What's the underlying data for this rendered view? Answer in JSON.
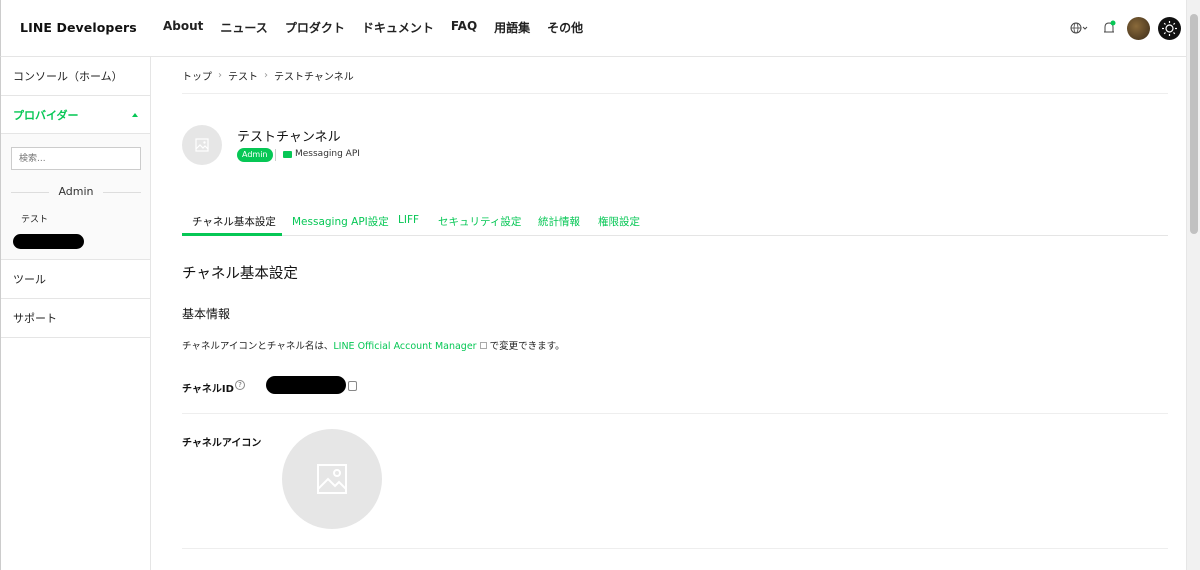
{
  "header": {
    "logo": "LINE Developers",
    "nav": [
      "About",
      "ニュース",
      "プロダクト",
      "ドキュメント",
      "FAQ",
      "用語集",
      "その他"
    ],
    "icons": {
      "language": "globe-icon",
      "notification": "bell-icon",
      "theme": "sun-icon"
    }
  },
  "sidebar": {
    "console_home": "コンソール（ホーム）",
    "provider": "プロバイダー",
    "search_placeholder": "検索...",
    "admin_label": "Admin",
    "provider_item": "テスト",
    "tools": "ツール",
    "support": "サポート"
  },
  "breadcrumb": [
    "トップ",
    "テスト",
    "テストチャンネル"
  ],
  "channel": {
    "name": "テストチャンネル",
    "role_badge": "Admin",
    "type": "Messaging API"
  },
  "tabs": [
    "チャネル基本設定",
    "Messaging API設定",
    "LIFF",
    "セキュリティ設定",
    "統計情報",
    "権限設定"
  ],
  "active_tab": "チャネル基本設定",
  "content": {
    "section_title": "チャネル基本設定",
    "subsection_title": "基本情報",
    "desc_before": "チャネルアイコンとチャネル名は、",
    "desc_link": "LINE Official Account Manager",
    "desc_after": "で変更できます。",
    "channel_id_label": "チャネルID",
    "channel_icon_label": "チャネルアイコン"
  },
  "colors": {
    "accent": "#06c755"
  }
}
